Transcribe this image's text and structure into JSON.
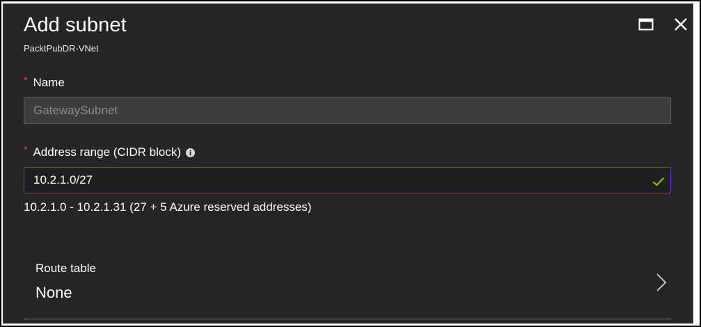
{
  "panel": {
    "title": "Add subnet",
    "subtitle": "PacktPubDR-VNet"
  },
  "window_controls": {
    "maximize_icon": "maximize-icon",
    "close_icon": "close-icon"
  },
  "name_field": {
    "required_marker": "*",
    "label": "Name",
    "value": "GatewaySubnet"
  },
  "address_field": {
    "required_marker": "*",
    "label": "Address range (CIDR block)",
    "info_icon": "info-icon",
    "value": "10.2.1.0/27",
    "valid_icon": "checkmark-icon",
    "range_description": "10.2.1.0 - 10.2.1.31 (27 + 5 Azure reserved addresses)"
  },
  "route_table": {
    "label": "Route table",
    "value": "None",
    "chevron_icon": "chevron-right-icon"
  },
  "colors": {
    "background": "#252525",
    "required": "#e5534b",
    "focus_border": "#8a2bb5",
    "valid": "#7fba00"
  }
}
